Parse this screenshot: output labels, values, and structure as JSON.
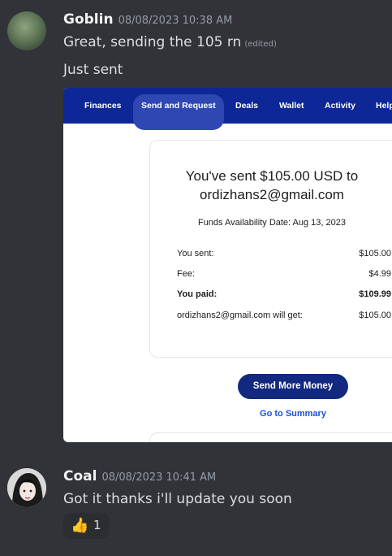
{
  "messages": [
    {
      "username": "Goblin",
      "timestamp": "08/08/2023 10:38 AM",
      "lines": [
        "Great, sending the 105 rn",
        "Just sent"
      ],
      "edited_label": "(edited)"
    },
    {
      "username": "Coal",
      "timestamp": "08/08/2023 10:41 AM",
      "lines": [
        "Got it thanks i'll update you soon"
      ],
      "reaction": {
        "emoji": "👍",
        "count": "1"
      }
    }
  ],
  "embed": {
    "nav": [
      "Finances",
      "Send and Request",
      "Deals",
      "Wallet",
      "Activity",
      "Help"
    ],
    "active_nav": "Send and Request",
    "title_line1": "You've sent $105.00 USD to",
    "title_line2": "ordizhans2@gmail.com",
    "availability": "Funds Availability Date: Aug 13, 2023",
    "rows": [
      {
        "label": "You sent:",
        "value": "$105.00"
      },
      {
        "label": "Fee:",
        "value": "$4.99"
      },
      {
        "label": "You paid:",
        "value": "$109.99"
      },
      {
        "label": "ordizhans2@gmail.com will get:",
        "value": "$105.00"
      }
    ],
    "send_more_button": "Send More Money",
    "summary_link": "Go to Summary"
  },
  "colors": {
    "background": "#313338",
    "nav_bar": "#0d2797",
    "button": "#13297f",
    "link": "#1a4fd8"
  }
}
